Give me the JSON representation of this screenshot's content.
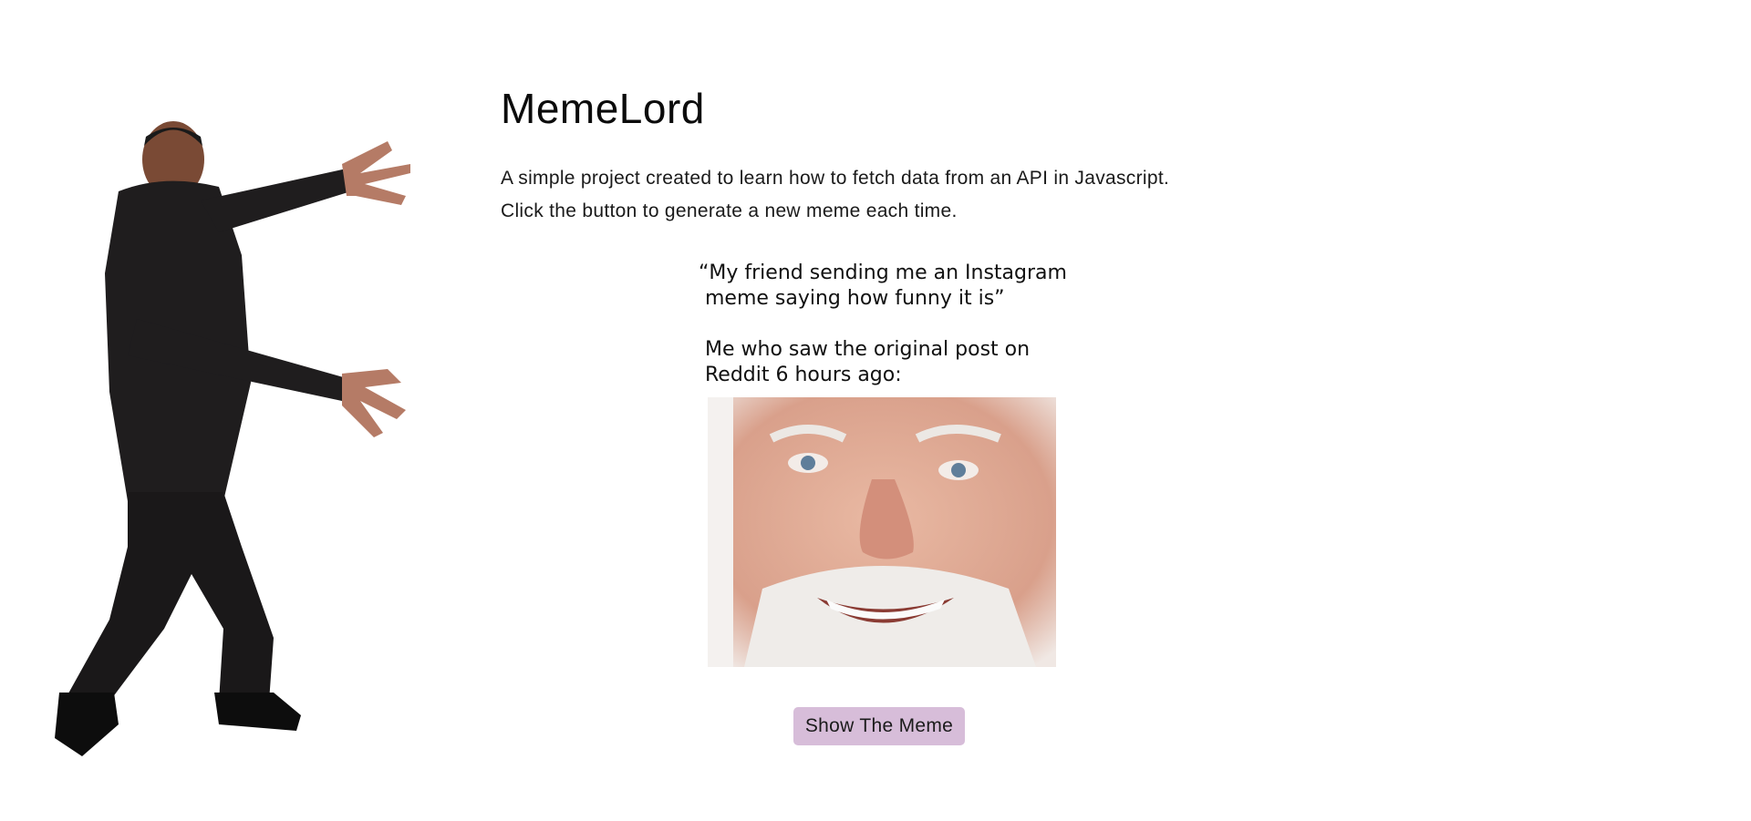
{
  "header": {
    "title": "MemeLord"
  },
  "intro": {
    "line1": "A simple project created to learn how to fetch data from an API in Javascript.",
    "line2": "Click the button to generate a new meme each time."
  },
  "meme": {
    "caption_lines": [
      "“My friend sending me an Instagram",
      " meme saying how funny it is”",
      "",
      " Me who saw the original post on",
      " Reddit 6 hours ago:"
    ]
  },
  "actions": {
    "show_button_label": "Show The Meme"
  },
  "colors": {
    "button_bg": "#d7bdd9",
    "text": "#111111",
    "background": "#ffffff"
  },
  "icons": {
    "hero_image": "man-in-suit-presenting-image",
    "meme_image": "smiling-elderly-man-face-image"
  }
}
